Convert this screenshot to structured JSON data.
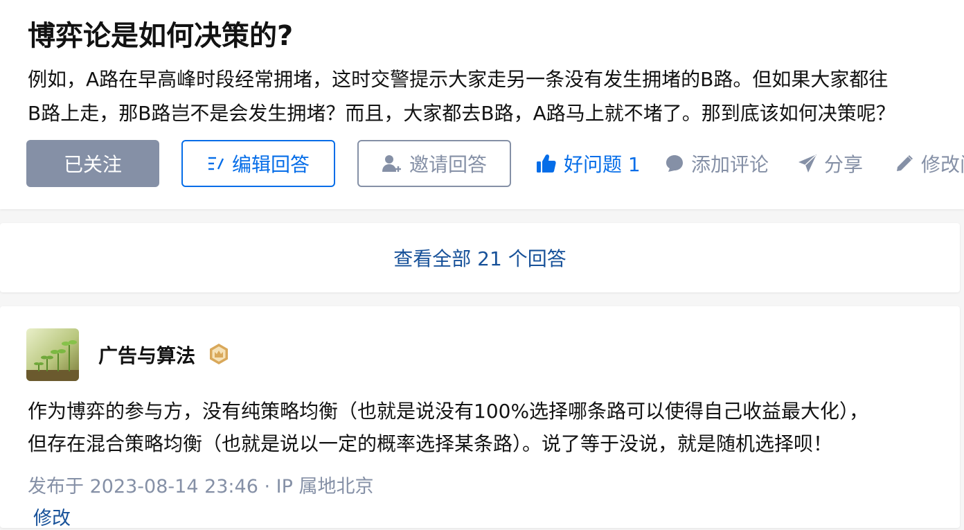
{
  "question": {
    "title": "博弈论是如何决策的?",
    "detail_lines": [
      "例如，A路在早高峰时段经常拥堵，这时交警提示大家走另一条没有发生拥堵的B路。但如果大家都往",
      "B路上走，那B路岂不是会发生拥堵？而且，大家都去B路，A路马上就不堵了。那到底该如何决策呢？"
    ]
  },
  "actions": {
    "followed_label": "已关注",
    "edit_answer_label": "编辑回答",
    "invite_label": "邀请回答",
    "good_question_label": "好问题 1",
    "comment_label": "添加评论",
    "share_label": "分享",
    "modify_label": "修改问题"
  },
  "view_all": {
    "label": "查看全部 21 个回答"
  },
  "answer": {
    "author_name": "广告与算法",
    "text_lines": [
      "作为博弈的参与方，没有纯策略均衡（也就是说没有100%选择哪条路可以使得自己收益最大化），",
      "但存在混合策略均衡（也就是说以一定的概率选择某条路）。说了等于没说，就是随机选择呗！"
    ],
    "publish_info": "发布于 2023-08-14 23:46 · IP 属地北京",
    "edit_label": "修改"
  },
  "colors": {
    "brand_blue": "#056de8",
    "link_blue": "#175199",
    "gray_text": "#8590a6",
    "followed_bg": "#8590a6"
  },
  "icons": {
    "edit_answer": "edit-list-icon",
    "invite": "add-user-icon",
    "good_question": "thumbs-up-icon",
    "comment": "comment-bubble-icon",
    "share": "paper-plane-icon",
    "modify": "pencil-icon",
    "badge": "crown-badge-icon"
  }
}
